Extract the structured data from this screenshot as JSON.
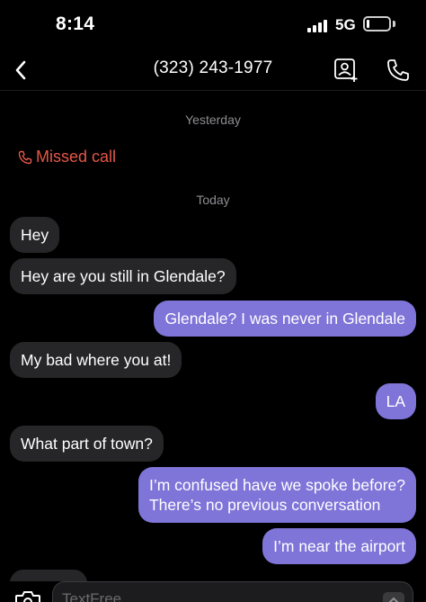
{
  "status_bar": {
    "time": "8:14",
    "network": "5G",
    "signal_bars": 4,
    "battery_level": 0.15
  },
  "header": {
    "title": "(323) 243-1977",
    "back_icon": "chevron-left-icon",
    "contact_icon": "contact-add-icon",
    "call_icon": "phone-icon"
  },
  "conversation": {
    "date_yesterday": "Yesterday",
    "missed_call": "Missed call",
    "date_today": "Today",
    "messages": [
      {
        "direction": "incoming",
        "text": "Hey"
      },
      {
        "direction": "incoming",
        "text": "Hey are you still in Glendale?"
      },
      {
        "direction": "outgoing",
        "text": "Glendale? I was never in Glendale"
      },
      {
        "direction": "incoming",
        "text": "My bad where you at!"
      },
      {
        "direction": "outgoing",
        "text": "LA"
      },
      {
        "direction": "incoming",
        "text": "What part of town?"
      },
      {
        "direction": "outgoing",
        "text": "I’m confused have we spoke before?"
      },
      {
        "direction": "outgoing",
        "text": "There’s no previous conversation"
      },
      {
        "direction": "outgoing",
        "text": "I’m near the airport"
      }
    ]
  },
  "composer": {
    "placeholder": "TextFree",
    "value": "",
    "camera_icon": "camera-icon",
    "send_icon": "send-icon"
  },
  "colors": {
    "background": "#000000",
    "incoming_bubble": "#262628",
    "outgoing_bubble": "#7f74d8",
    "missed_call": "#e5574a",
    "date_text": "#8e8e93"
  }
}
